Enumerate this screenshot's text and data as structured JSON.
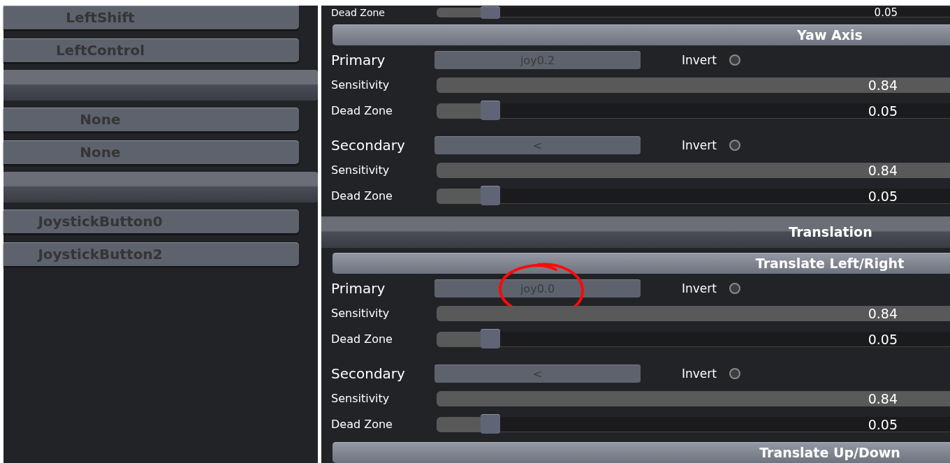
{
  "key_list": [
    {
      "kind": "key",
      "label": "LeftShift"
    },
    {
      "kind": "key",
      "label": "LeftControl"
    },
    {
      "kind": "header"
    },
    {
      "kind": "key",
      "label": "None"
    },
    {
      "kind": "key",
      "label": "None"
    },
    {
      "kind": "header"
    },
    {
      "kind": "key",
      "label": "JoystickButton0"
    },
    {
      "kind": "key",
      "label": "JoystickButton2"
    }
  ],
  "axis_panel": [
    {
      "kind": "slider",
      "label": "Dead Zone",
      "value": "0.05",
      "level": 0.105
    },
    {
      "kind": "subheader",
      "title": "Yaw Axis"
    },
    {
      "kind": "binding",
      "label": "Primary",
      "binding": "joy0.2",
      "invert_label": "Invert",
      "inverted": false,
      "circled": false
    },
    {
      "kind": "slider",
      "label": "Sensitivity",
      "value": "0.84",
      "level": 1
    },
    {
      "kind": "slider",
      "label": "Dead Zone",
      "value": "0.05",
      "level": 0.105
    },
    {
      "kind": "binding",
      "label": "Secondary",
      "binding": "<",
      "invert_label": "Invert",
      "inverted": false,
      "circled": false
    },
    {
      "kind": "slider",
      "label": "Sensitivity",
      "value": "0.84",
      "level": 1
    },
    {
      "kind": "slider",
      "label": "Dead Zone",
      "value": "0.05",
      "level": 0.105
    },
    {
      "kind": "header",
      "title": "Translation"
    },
    {
      "kind": "subheader",
      "title": "Translate Left/Right"
    },
    {
      "kind": "binding",
      "label": "Primary",
      "binding": "joy0.0",
      "invert_label": "Invert",
      "inverted": false,
      "circled": true
    },
    {
      "kind": "slider",
      "label": "Sensitivity",
      "value": "0.84",
      "level": 1
    },
    {
      "kind": "slider",
      "label": "Dead Zone",
      "value": "0.05",
      "level": 0.105
    },
    {
      "kind": "binding",
      "label": "Secondary",
      "binding": "<",
      "invert_label": "Invert",
      "inverted": false,
      "circled": false
    },
    {
      "kind": "slider",
      "label": "Sensitivity",
      "value": "0.84",
      "level": 1
    },
    {
      "kind": "slider",
      "label": "Dead Zone",
      "value": "0.05",
      "level": 0.105
    },
    {
      "kind": "subheader",
      "title": "Translate Up/Down"
    }
  ]
}
